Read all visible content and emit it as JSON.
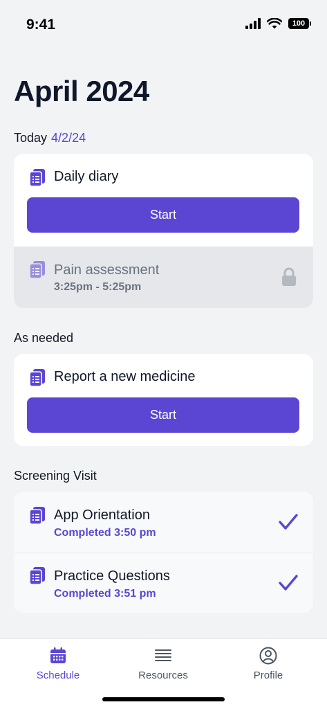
{
  "status_bar": {
    "time": "9:41",
    "battery": "100"
  },
  "header": {
    "title": "April 2024"
  },
  "today": {
    "label": "Today",
    "date": "4/2/24",
    "items": [
      {
        "title": "Daily diary",
        "button_label": "Start"
      },
      {
        "title": "Pain assessment",
        "time_range": "3:25pm - 5:25pm"
      }
    ]
  },
  "as_needed": {
    "label": "As needed",
    "items": [
      {
        "title": "Report a new medicine",
        "button_label": "Start"
      }
    ]
  },
  "screening": {
    "label": "Screening Visit",
    "items": [
      {
        "title": "App Orientation",
        "status": "Completed 3:50 pm"
      },
      {
        "title": "Practice Questions",
        "status": "Completed 3:51 pm"
      }
    ]
  },
  "tabs": [
    {
      "label": "Schedule",
      "icon": "calendar-icon",
      "active": true
    },
    {
      "label": "Resources",
      "icon": "list-icon",
      "active": false
    },
    {
      "label": "Profile",
      "icon": "user-circle-icon",
      "active": false
    }
  ],
  "colors": {
    "accent": "#5b46d3",
    "background": "#f2f3f5",
    "locked": "#e5e7eb",
    "inactive_tab": "#4b5563"
  }
}
